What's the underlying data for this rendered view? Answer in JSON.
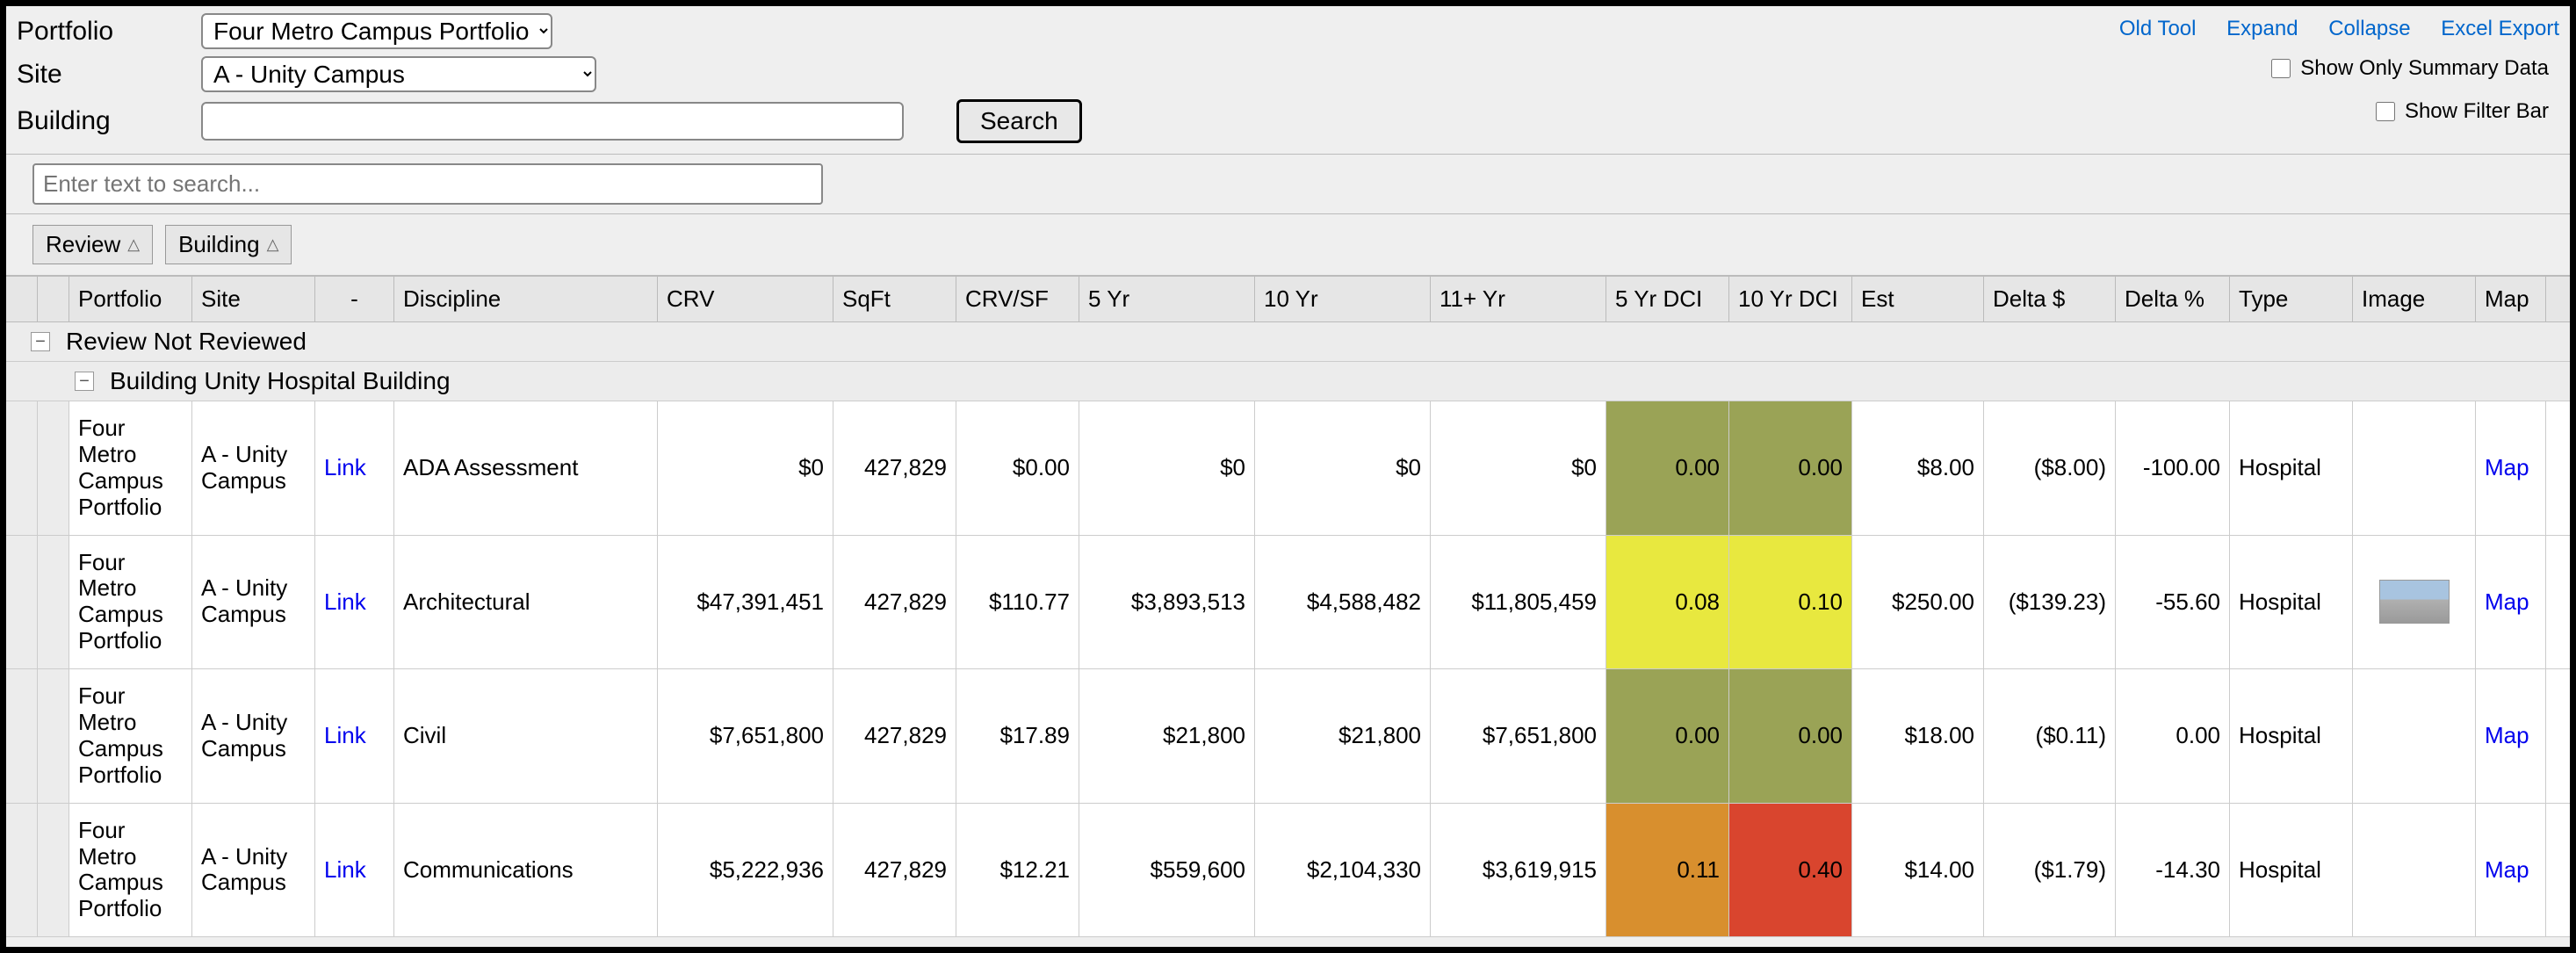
{
  "filters": {
    "portfolio_label": "Portfolio",
    "site_label": "Site",
    "building_label": "Building",
    "portfolio_value": "Four Metro Campus Portfolio",
    "site_value": "A - Unity Campus",
    "building_value": "",
    "search_btn": "Search"
  },
  "top_links": {
    "old_tool": "Old Tool",
    "expand": "Expand",
    "collapse": "Collapse",
    "excel": "Excel Export"
  },
  "checkboxes": {
    "summary_label": "Show Only Summary Data",
    "summary_checked": false,
    "filterbar_label": "Show Filter Bar",
    "filterbar_checked": false
  },
  "grid_search_placeholder": "Enter text to search...",
  "group_chips": {
    "review": "Review",
    "building": "Building"
  },
  "columns": {
    "portfolio": "Portfolio",
    "site": "Site",
    "link": "-",
    "discipline": "Discipline",
    "crv": "CRV",
    "sqft": "SqFt",
    "crvsf": "CRV/SF",
    "yr5": "5 Yr",
    "yr10": "10 Yr",
    "yr11": "11+ Yr",
    "dci5": "5 Yr DCI",
    "dci10": "10 Yr DCI",
    "est": "Est",
    "delta": "Delta $",
    "deltapct": "Delta %",
    "type": "Type",
    "image": "Image",
    "map": "Map"
  },
  "groups": {
    "review_label": "Review Not Reviewed",
    "building_label": "Building Unity Hospital Building"
  },
  "link_text": "Link",
  "map_text": "Map",
  "rows": [
    {
      "portfolio": "Four Metro Campus Portfolio",
      "site": "A - Unity Campus",
      "discipline": "ADA Assessment",
      "crv": "$0",
      "sqft": "427,829",
      "crvsf": "$0.00",
      "yr5": "$0",
      "yr10": "$0",
      "yr11": "$0",
      "dci5": "0.00",
      "dci10": "0.00",
      "dci5_class": "dci-olive",
      "dci10_class": "dci-olive",
      "est": "$8.00",
      "delta": "($8.00)",
      "deltapct": "-100.00",
      "type": "Hospital",
      "has_image": false
    },
    {
      "portfolio": "Four Metro Campus Portfolio",
      "site": "A - Unity Campus",
      "discipline": "Architectural",
      "crv": "$47,391,451",
      "sqft": "427,829",
      "crvsf": "$110.77",
      "yr5": "$3,893,513",
      "yr10": "$4,588,482",
      "yr11": "$11,805,459",
      "dci5": "0.08",
      "dci10": "0.10",
      "dci5_class": "dci-yellow",
      "dci10_class": "dci-yellow",
      "est": "$250.00",
      "delta": "($139.23)",
      "deltapct": "-55.60",
      "type": "Hospital",
      "has_image": true
    },
    {
      "portfolio": "Four Metro Campus Portfolio",
      "site": "A - Unity Campus",
      "discipline": "Civil",
      "crv": "$7,651,800",
      "sqft": "427,829",
      "crvsf": "$17.89",
      "yr5": "$21,800",
      "yr10": "$21,800",
      "yr11": "$7,651,800",
      "dci5": "0.00",
      "dci10": "0.00",
      "dci5_class": "dci-olive",
      "dci10_class": "dci-olive",
      "est": "$18.00",
      "delta": "($0.11)",
      "deltapct": "0.00",
      "type": "Hospital",
      "has_image": false
    },
    {
      "portfolio": "Four Metro Campus Portfolio",
      "site": "A - Unity Campus",
      "discipline": "Communications",
      "crv": "$5,222,936",
      "sqft": "427,829",
      "crvsf": "$12.21",
      "yr5": "$559,600",
      "yr10": "$2,104,330",
      "yr11": "$3,619,915",
      "dci5": "0.11",
      "dci10": "0.40",
      "dci5_class": "dci-orange",
      "dci10_class": "dci-red",
      "est": "$14.00",
      "delta": "($1.79)",
      "deltapct": "-14.30",
      "type": "Hospital",
      "has_image": false
    }
  ]
}
